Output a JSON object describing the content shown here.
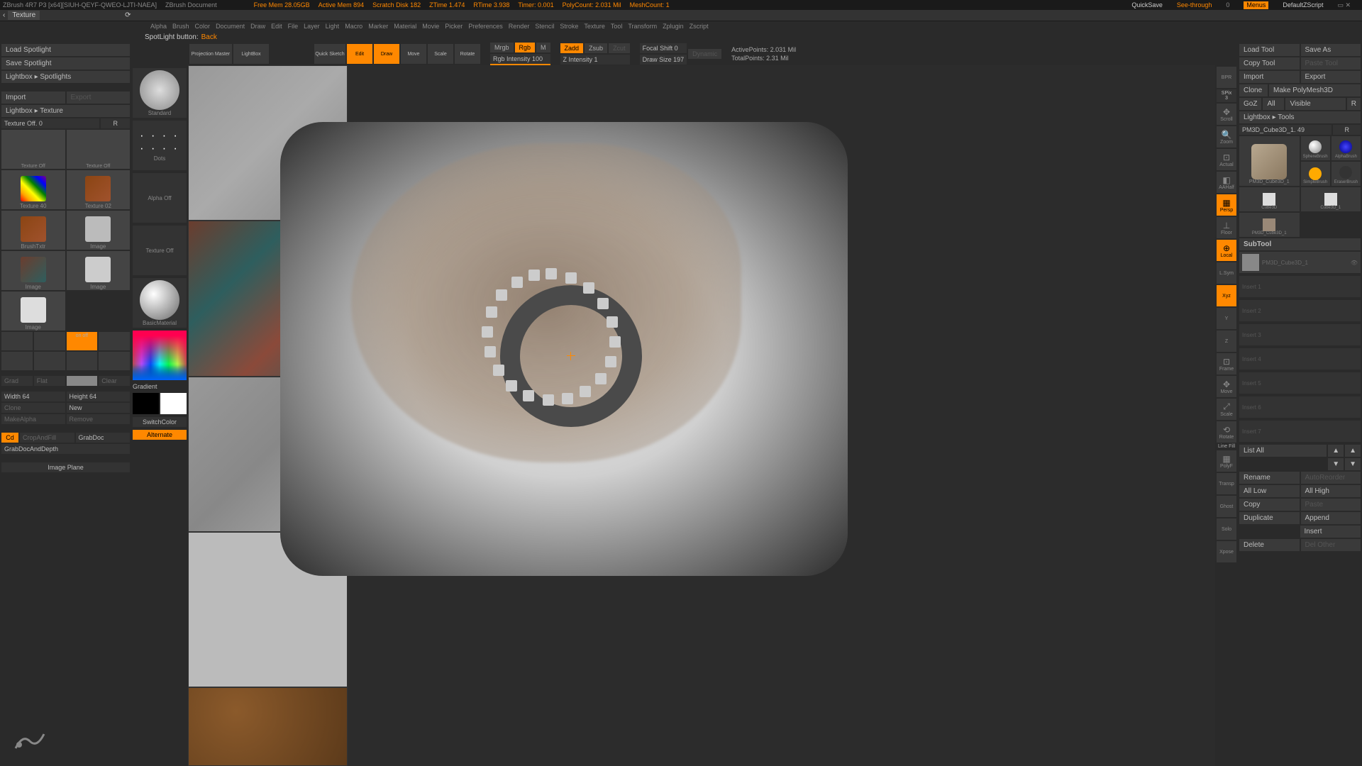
{
  "topbar": {
    "app": "ZBrush 4R7 P3 [x64][SIUH-QEYF-QWEO-LJTI-NAEA]",
    "doc": "ZBrush Document",
    "memFree": "Free Mem 28.05GB",
    "memActive": "Active Mem 894",
    "scratch": "Scratch Disk 182",
    "ztime": "ZTime 1.474",
    "rtime": "RTime 3.938",
    "timer": "Timer: 0.001",
    "polycount": "PolyCount: 2.031 Mil",
    "meshcount": "MeshCount: 1",
    "quicksave": "QuickSave",
    "seethrough": "See-through",
    "seethroughVal": "0",
    "menus": "Menus",
    "script": "DefaultZScript"
  },
  "title": "Texture",
  "menubar": [
    "Alpha",
    "Brush",
    "Color",
    "Document",
    "Draw",
    "Edit",
    "File",
    "Layer",
    "Light",
    "Macro",
    "Marker",
    "Material",
    "Movie",
    "Picker",
    "Preferences",
    "Render",
    "Stencil",
    "Stroke",
    "Texture",
    "Tool",
    "Transform",
    "Zplugin",
    "Zscript"
  ],
  "status": {
    "prefix": "SpotLight button:",
    "value": "Back"
  },
  "leftPanel": {
    "loadSpotlight": "Load Spotlight",
    "saveSpotlight": "Save Spotlight",
    "lightboxSpotlights": "Lightbox ▸ Spotlights",
    "import": "Import",
    "export": "Export",
    "lightboxTexture": "Lightbox ▸ Texture",
    "textureOff": "Texture Off. 0",
    "r": "R",
    "textureOffLabel": "Texture Off",
    "texture40": "Texture 40",
    "texture02": "Texture 02",
    "brushTxtr": "BrushTxtr",
    "image": "Image",
    "onoff": "on off",
    "grad": "Grad",
    "flat": "Flat",
    "sec": " ",
    "clear": "Clear",
    "width": "Width 64",
    "height": "Height 64",
    "clone": "Clone",
    "new": "New",
    "makeAlpha": "MakeAlpha",
    "remove": "Remove",
    "cd": "Cd",
    "cropAndFill": "CropAndFill",
    "grabDoc": "GrabDoc",
    "grabDocAndDepth": "GrabDocAndDepth",
    "imagePlane": "Image Plane"
  },
  "brushPanel": {
    "standard": "Standard",
    "dots": "Dots",
    "alphaOff": "Alpha Off",
    "textureOff": "Texture Off",
    "basicMaterial": "BasicMaterial",
    "gradient": "Gradient",
    "switchColor": "SwitchColor",
    "alternate": "Alternate"
  },
  "toolbar": {
    "projMaster": "Projection Master",
    "lightbox": "LightBox",
    "quickSketch": "Quick Sketch",
    "edit": "Edit",
    "draw": "Draw",
    "move": "Move",
    "scale": "Scale",
    "rotate": "Rotate",
    "mrgb": "Mrgb",
    "rgb": "Rgb",
    "m": "M",
    "rgbIntensity": "Rgb Intensity 100",
    "zadd": "Zadd",
    "zsub": "Zsub",
    "zcut": "Zcut",
    "zIntensity": "Z Intensity 1",
    "focalShift": "Focal Shift 0",
    "drawSize": "Draw Size 197",
    "dynamic": "Dynamic",
    "activePoints": "ActivePoints: 2.031 Mil",
    "totalPoints": "TotalPoints: 2.31 Mil"
  },
  "rightButtons": {
    "bpr": "BPR",
    "spix": "SPix 3",
    "scroll": "Scroll",
    "zoom": "Zoom",
    "actual": "Actual",
    "aaHalf": "AAHalf",
    "persp": "Persp",
    "floor": "Floor",
    "local": "Local",
    "lsym": "L.Sym",
    "xyz": "Xyz",
    "frame": "Frame",
    "move": "Move",
    "scale": "Scale",
    "rotate": "Rotate",
    "lineFill": "Line Fill",
    "polyF": "PolyF",
    "transp": "Transp",
    "ghost": "Ghost",
    "solo": "Solo",
    "xpose": "Xpose"
  },
  "rightPanel": {
    "loadTool": "Load Tool",
    "saveAs": "Save As",
    "copyTool": "Copy Tool",
    "pasteTool": "Paste Tool",
    "import": "Import",
    "export": "Export",
    "clone": "Clone",
    "makePolymesh": "Make PolyMesh3D",
    "goz": "GoZ",
    "all": "All",
    "visible": "Visible",
    "r": "R",
    "lightboxTools": "Lightbox ▸ Tools",
    "currentTool": "PM3D_Cube3D_1. 49",
    "tools": {
      "main": "PM3D_Cube3D_1",
      "sphere": "SphereBrush",
      "simple": "SimpleBrush",
      "alpha": "AlphaBrush",
      "eraser": "EraserBrush",
      "cube": "Cube3D",
      "cube2": "Cube3D_1",
      "pm3d": "PM3D_Cube3D_1"
    },
    "subtool": "SubTool",
    "subtoolActive": "PM3D_Cube3D_1",
    "insert": [
      "Insert 1",
      "Insert 2",
      "Insert 3",
      "Insert 4",
      "Insert 5",
      "Insert 6",
      "Insert 7"
    ],
    "listAll": "List All",
    "rename": "Rename",
    "autoReorder": "AutoReorder",
    "allLow": "All Low",
    "allHigh": "All High",
    "copy": "Copy",
    "paste": "Paste",
    "duplicate": "Duplicate",
    "append": "Append",
    "insert2": "Insert",
    "delete": "Delete",
    "delOther": "Del Other"
  }
}
